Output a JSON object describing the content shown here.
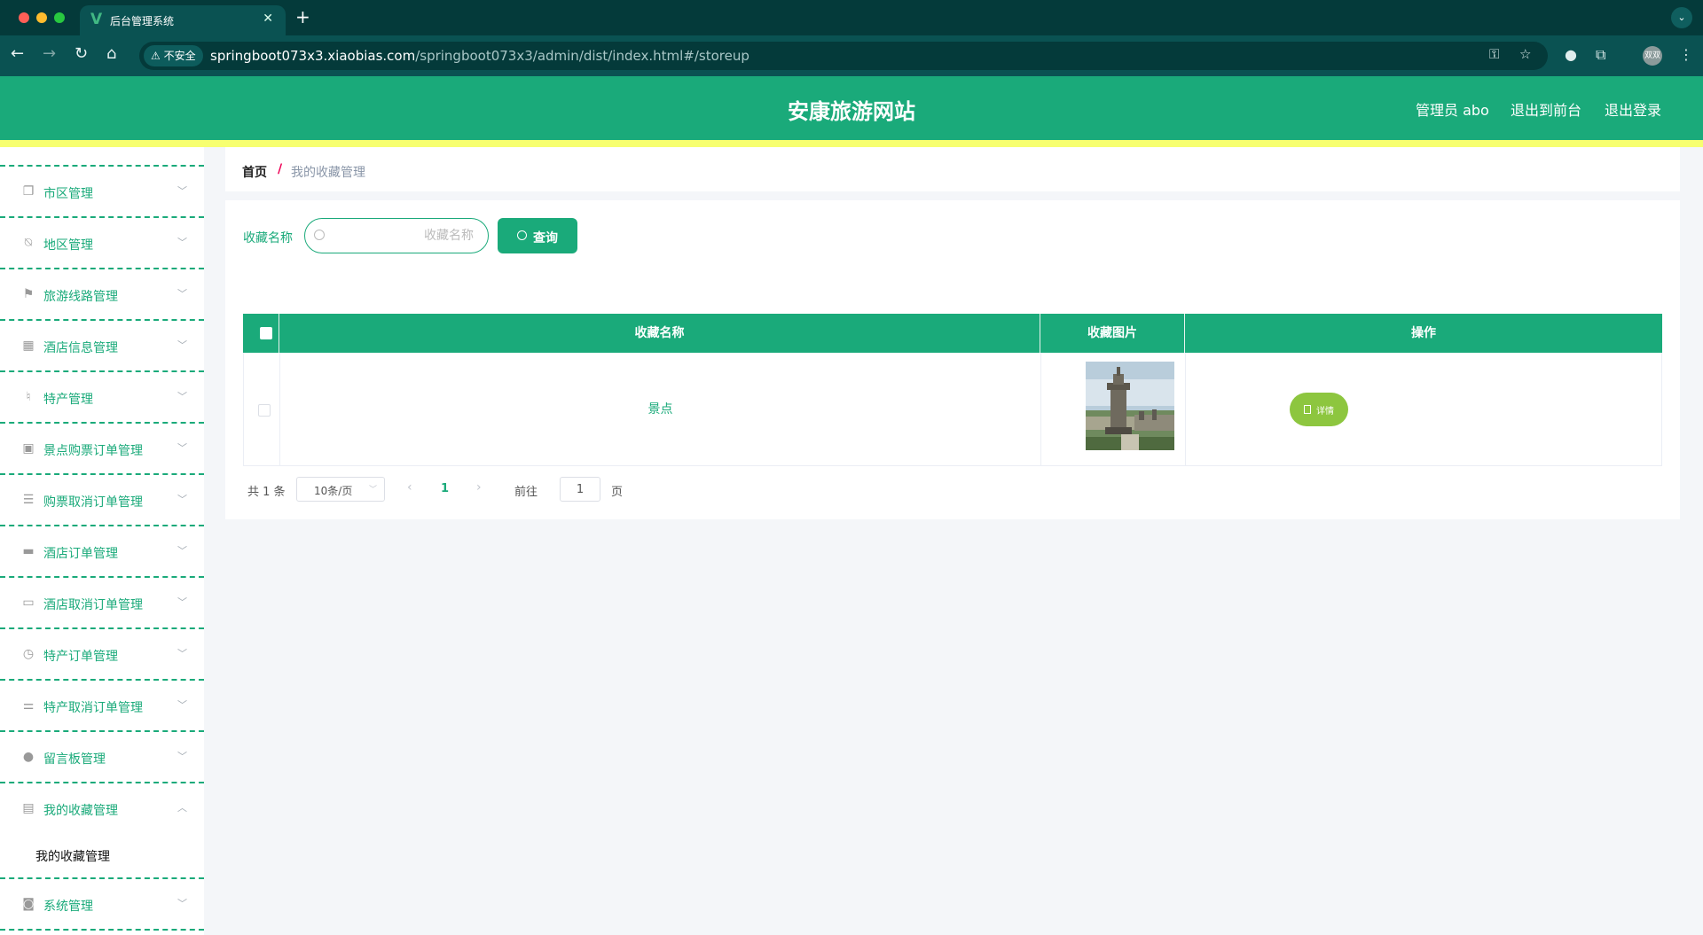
{
  "browser": {
    "tab_title": "后台管理系统",
    "tab_favicon": "V",
    "insecure_label": "不安全",
    "url_host": "springboot073x3.xiaobias.com",
    "url_path": "/springboot073x3/admin/dist/index.html#/storeup",
    "profile_initials": "双双"
  },
  "header": {
    "title": "安康旅游网站",
    "user_label": "管理员 abo",
    "to_front_label": "退出到前台",
    "logout_label": "退出登录"
  },
  "sidebar": {
    "items": [
      {
        "label": "市区管理",
        "icon": "copy-icon"
      },
      {
        "label": "地区管理",
        "icon": "bell-off-icon"
      },
      {
        "label": "旅游线路管理",
        "icon": "flag-icon"
      },
      {
        "label": "酒店信息管理",
        "icon": "grid-icon"
      },
      {
        "label": "特产管理",
        "icon": "microphone-icon"
      },
      {
        "label": "景点购票订单管理",
        "icon": "ticket-icon"
      },
      {
        "label": "购票取消订单管理",
        "icon": "list-icon"
      },
      {
        "label": "酒店订单管理",
        "icon": "monitor-icon"
      },
      {
        "label": "酒店取消订单管理",
        "icon": "print-icon"
      },
      {
        "label": "特产订单管理",
        "icon": "clock-icon"
      },
      {
        "label": "特产取消订单管理",
        "icon": "sliders-icon"
      },
      {
        "label": "留言板管理",
        "icon": "balloon-icon"
      },
      {
        "label": "我的收藏管理",
        "icon": "clipboard-icon"
      },
      {
        "label": "系统管理",
        "icon": "camera-icon"
      }
    ],
    "sub_active": "我的收藏管理"
  },
  "breadcrumb": {
    "home": "首页",
    "separator": "/",
    "current": "我的收藏管理"
  },
  "search": {
    "label": "收藏名称",
    "placeholder": "收藏名称",
    "value": "",
    "button": "查询"
  },
  "table": {
    "columns": [
      "收藏名称",
      "收藏图片",
      "操作"
    ],
    "rows": [
      {
        "name": "景点",
        "image": "monument-photo",
        "action": "详情"
      }
    ]
  },
  "pagination": {
    "total": "共 1 条",
    "page_size": "10条/页",
    "current_page": "1",
    "goto_label": "前往",
    "goto_value": "1",
    "page_suffix": "页"
  },
  "colors": {
    "primary": "#1aaa7a",
    "header_bg": "#1aaa7a",
    "accent_bar": "#f7ff70",
    "detail_button": "#8dc63f",
    "breadcrumb_separator": "#ee0055"
  }
}
